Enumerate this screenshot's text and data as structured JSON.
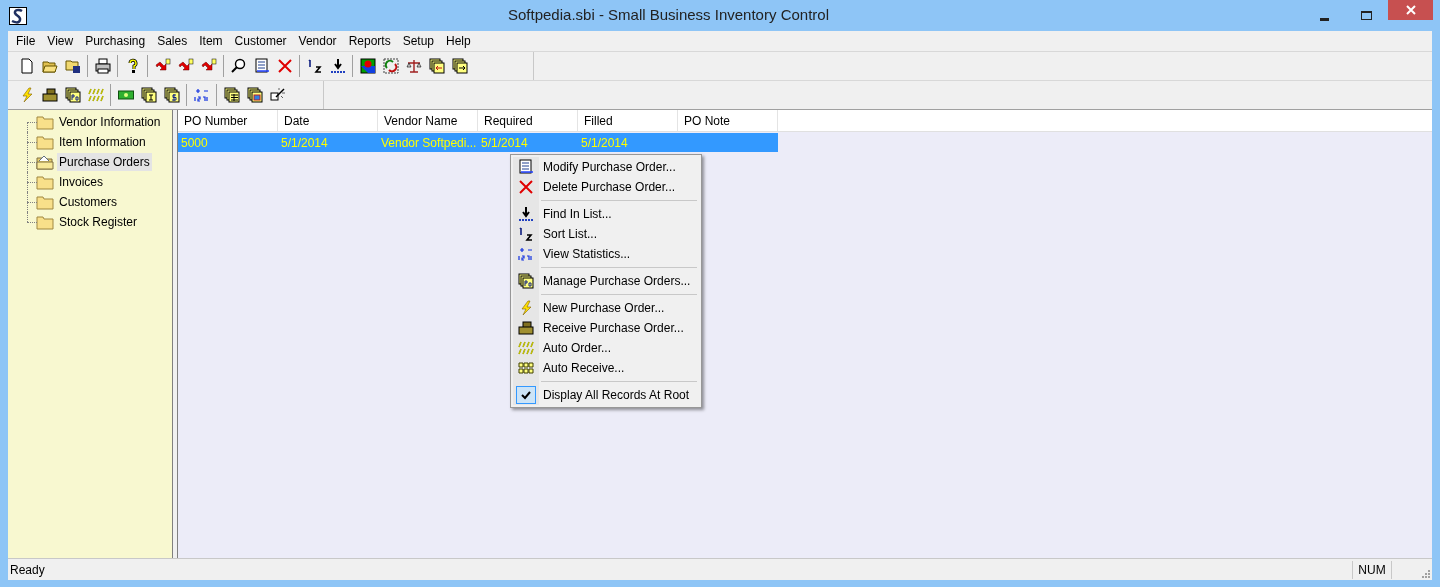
{
  "window": {
    "title": "Softpedia.sbi - Small Business Inventory Control"
  },
  "menu_bar": [
    "File",
    "View",
    "Purchasing",
    "Sales",
    "Item",
    "Customer",
    "Vendor",
    "Reports",
    "Setup",
    "Help"
  ],
  "tree": [
    {
      "label": "Vendor Information",
      "selected": false
    },
    {
      "label": "Item Information",
      "selected": false
    },
    {
      "label": "Purchase Orders",
      "selected": true
    },
    {
      "label": "Invoices",
      "selected": false
    },
    {
      "label": "Customers",
      "selected": false
    },
    {
      "label": "Stock Register",
      "selected": false
    }
  ],
  "table": {
    "columns": [
      "PO Number",
      "Date",
      "Vendor Name",
      "Required",
      "Filled",
      "PO Note"
    ],
    "rows": [
      {
        "selected": true,
        "cells": [
          "5000",
          "5/1/2014",
          "Vendor Softpedi...",
          "5/1/2014",
          "5/1/2014",
          ""
        ]
      }
    ]
  },
  "context_menu": {
    "groups": [
      [
        {
          "label": "Modify Purchase Order..."
        },
        {
          "label": "Delete Purchase Order..."
        }
      ],
      [
        {
          "label": "Find In List..."
        },
        {
          "label": "Sort List..."
        },
        {
          "label": "View Statistics..."
        }
      ],
      [
        {
          "label": "Manage Purchase Orders..."
        }
      ],
      [
        {
          "label": "New Purchase Order..."
        },
        {
          "label": "Receive Purchase Order..."
        },
        {
          "label": "Auto Order..."
        },
        {
          "label": "Auto Receive..."
        }
      ],
      [
        {
          "label": "Display All Records At Root",
          "checked": true
        }
      ]
    ]
  },
  "status_bar": {
    "message": "Ready",
    "indicator": "NUM"
  }
}
